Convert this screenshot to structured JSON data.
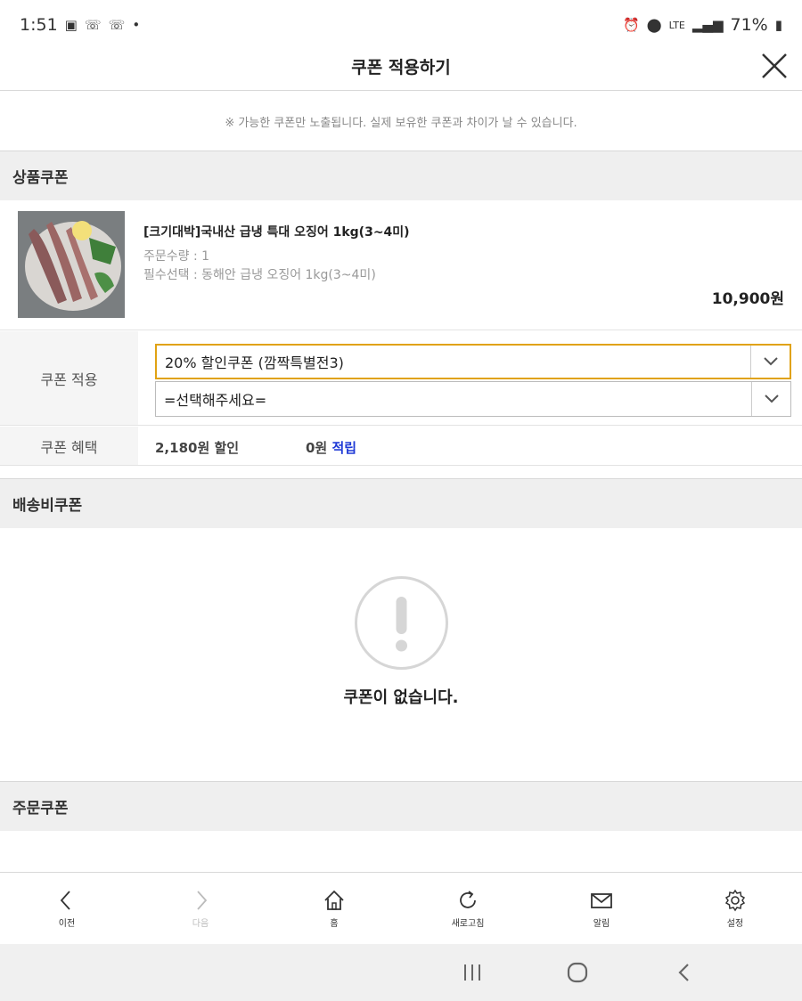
{
  "status_bar": {
    "time": "1:51",
    "battery": "71%",
    "network": "LTE"
  },
  "header": {
    "title": "쿠폰 적용하기"
  },
  "notice": "※ 가능한 쿠폰만 노출됩니다. 실제 보유한 쿠폰과 차이가 날 수 있습니다.",
  "sections": {
    "product_coupon": "상품쿠폰",
    "shipping_coupon": "배송비쿠폰",
    "order_coupon": "주문쿠폰"
  },
  "product": {
    "name": "[크기대박]국내산 급냉 특대 오징어 1kg(3~4미)",
    "quantity": "주문수량 : 1",
    "option": "필수선택 : 동해안 급냉 오징어 1kg(3~4미)",
    "price": "10,900원"
  },
  "coupon_apply": {
    "label": "쿠폰 적용",
    "selected": "20% 할인쿠폰 (깜짝특별전3)",
    "second": "=선택해주세요="
  },
  "coupon_benefit": {
    "label": "쿠폰 혜택",
    "discount": "2,180원 할인",
    "points_amount": "0원",
    "points_word": "적립"
  },
  "empty_state": {
    "text": "쿠폰이 없습니다."
  },
  "browser_nav": {
    "back": "이전",
    "forward": "다음",
    "home": "홈",
    "refresh": "새로고침",
    "notifications": "알림",
    "settings": "설정"
  },
  "colors": {
    "accent": "#e0a213",
    "link_blue": "#1f3ad6",
    "section_bg": "#efefef"
  }
}
